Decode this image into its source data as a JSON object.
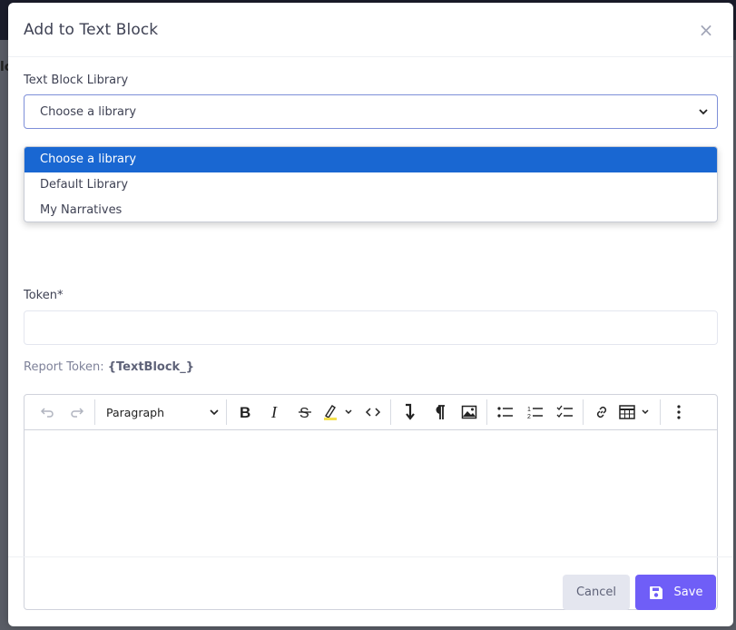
{
  "backdrop": {
    "peek_text": "lc"
  },
  "modal": {
    "title": "Add to Text Block",
    "close_symbol": "×"
  },
  "library": {
    "label": "Text Block Library",
    "selected": "Choose a library",
    "options": [
      "Choose a library",
      "Default Library",
      "My Narratives"
    ]
  },
  "token": {
    "label": "Token*",
    "value": "",
    "report_prefix": "Report Token: ",
    "report_value": "{TextBlock_}"
  },
  "toolbar": {
    "paragraph_label": "Paragraph",
    "icons": [
      "undo-icon",
      "redo-icon",
      "bold-icon",
      "italic-icon",
      "strikethrough-icon",
      "highlight-icon",
      "code-icon",
      "page-break-icon",
      "paragraph-mark-icon",
      "image-icon",
      "bulleted-list-icon",
      "numbered-list-icon",
      "todo-list-icon",
      "link-icon",
      "table-icon",
      "more-icon"
    ]
  },
  "footer": {
    "cancel_label": "Cancel",
    "save_label": "Save"
  },
  "colors": {
    "accent": "#6f5ef7",
    "selected_option": "#1967d2",
    "select_border": "#7e8fd8"
  }
}
